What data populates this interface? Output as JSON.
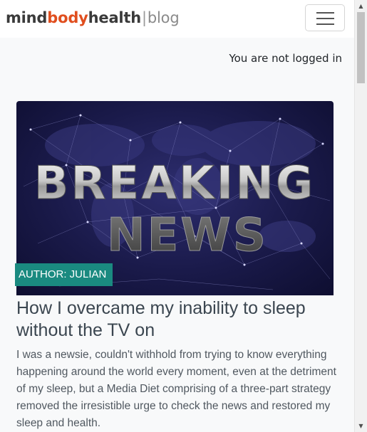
{
  "navbar": {
    "brand": {
      "part1": "mind",
      "part2": "body",
      "part3": "health",
      "separator": "|",
      "part4": "blog"
    },
    "toggle_icon": "hamburger-menu-icon"
  },
  "header": {
    "login_status": "You are not logged in"
  },
  "post": {
    "image": {
      "headline_line1": "BREAKING",
      "headline_line2": "NEWS"
    },
    "author_badge": "AUTHOR: JULIAN",
    "title": "How I overcame my inability to sleep without the TV on",
    "excerpt": "I was a newsie, couldn't withhold from trying to know everything happening around the world every moment, even at the detriment of my sleep, but a Media Diet comprising of a three-part strategy removed the irresistible urge to check the news and restored my sleep and health."
  },
  "colors": {
    "brand_accent": "#e04e1e",
    "badge": "#1a8a80",
    "hero_background": "#1a1a4a"
  }
}
